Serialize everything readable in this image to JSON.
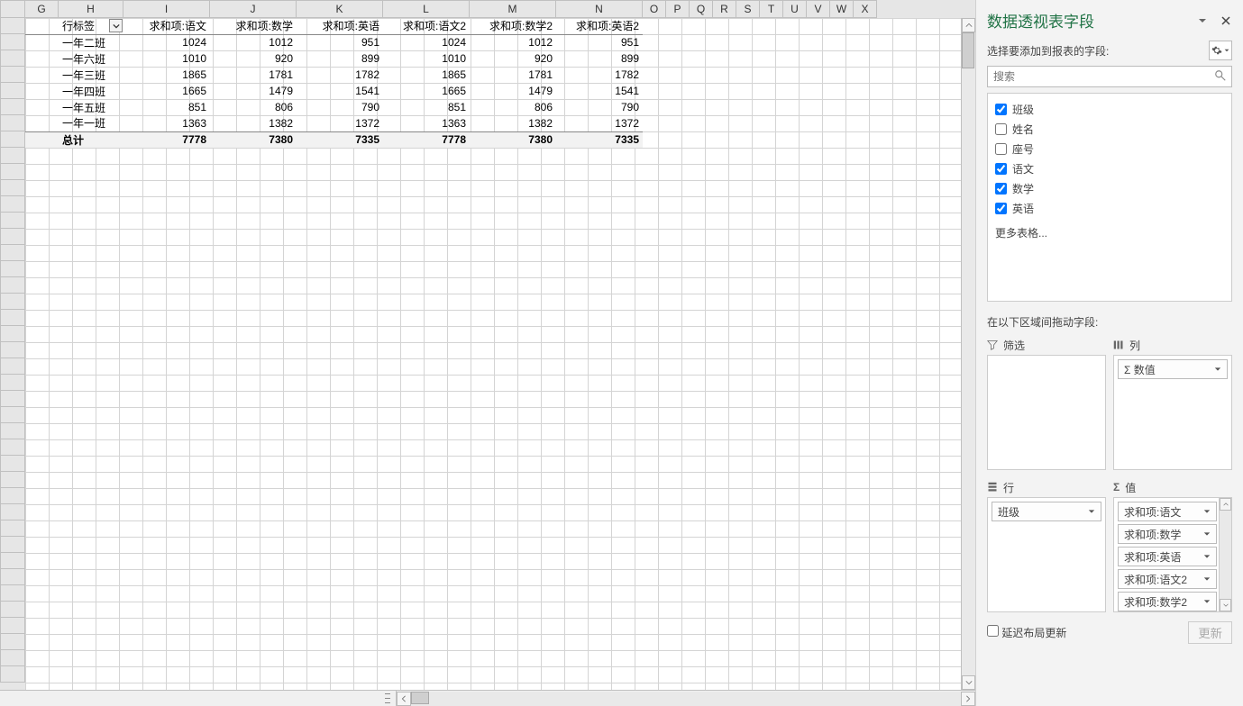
{
  "col_headers": [
    "G",
    "H",
    "I",
    "J",
    "K",
    "L",
    "M",
    "N",
    "O",
    "P",
    "Q",
    "R",
    "S",
    "T",
    "U",
    "V",
    "W",
    "X"
  ],
  "pivot": {
    "row_label_header": "行标签",
    "headers": [
      "求和项:语文",
      "求和项:数学",
      "求和项:英语",
      "求和项:语文2",
      "求和项:数学2",
      "求和项:英语2"
    ],
    "rows": [
      {
        "label": "一年二班",
        "vals": [
          1024,
          1012,
          951,
          1024,
          1012,
          951
        ]
      },
      {
        "label": "一年六班",
        "vals": [
          1010,
          920,
          899,
          1010,
          920,
          899
        ]
      },
      {
        "label": "一年三班",
        "vals": [
          1865,
          1781,
          1782,
          1865,
          1781,
          1782
        ]
      },
      {
        "label": "一年四班",
        "vals": [
          1665,
          1479,
          1541,
          1665,
          1479,
          1541
        ]
      },
      {
        "label": "一年五班",
        "vals": [
          851,
          806,
          790,
          851,
          806,
          790
        ]
      },
      {
        "label": "一年一班",
        "vals": [
          1363,
          1382,
          1372,
          1363,
          1382,
          1372
        ]
      }
    ],
    "total_label": "总计",
    "totals": [
      7778,
      7380,
      7335,
      7778,
      7380,
      7335
    ]
  },
  "panel": {
    "title": "数据透视表字段",
    "choose_label": "选择要添加到报表的字段:",
    "search_placeholder": "搜索",
    "fields": [
      {
        "label": "班级",
        "checked": true
      },
      {
        "label": "姓名",
        "checked": false
      },
      {
        "label": "座号",
        "checked": false
      },
      {
        "label": "语文",
        "checked": true
      },
      {
        "label": "数学",
        "checked": true
      },
      {
        "label": "英语",
        "checked": true
      }
    ],
    "more_tables": "更多表格...",
    "drag_hint": "在以下区域间拖动字段:",
    "area_filter": "筛选",
    "area_columns": "列",
    "area_rows": "行",
    "area_values": "值",
    "columns_items": [
      "Σ 数值"
    ],
    "rows_items": [
      "班级"
    ],
    "values_items": [
      "求和项:语文",
      "求和项:数学",
      "求和项:英语",
      "求和项:语文2",
      "求和项:数学2"
    ],
    "defer_label": "延迟布局更新",
    "update_btn": "更新"
  }
}
